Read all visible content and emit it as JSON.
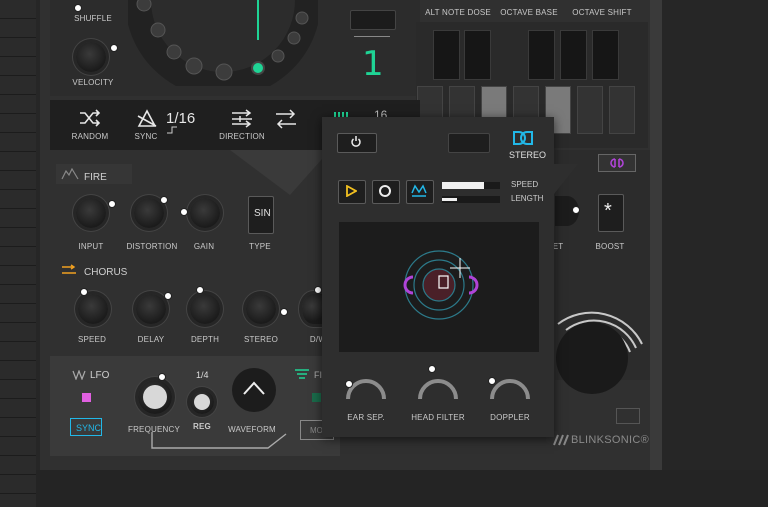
{
  "top": {
    "shuffle_label": "SHUFFLE",
    "velocity_label": "VELOCITY",
    "step_value": "1",
    "alt_note_dose_label": "ALT NOTE DOSE",
    "octave_base_label": "OCTAVE BASE",
    "octave_shift_label": "OCTAVE SHIFT"
  },
  "seqbar": {
    "random_label": "RANDOM",
    "sync_label": "SYNC",
    "rate_value": "1/16",
    "direction_label": "DIRECTION",
    "steps_value": "16"
  },
  "fire": {
    "title": "FIRE",
    "input_label": "INPUT",
    "distortion_label": "DISTORTION",
    "gain_label": "GAIN",
    "type_value": "SIN",
    "type_label": "TYPE"
  },
  "chorus": {
    "title": "CHORUS",
    "speed_label": "SPEED",
    "delay_label": "DELAY",
    "depth_label": "DEPTH",
    "stereo_label": "STEREO",
    "dw_label": "D/W"
  },
  "lfo": {
    "title": "LFO",
    "sync_label": "SYNC",
    "frequency_label": "FREQUENCY",
    "reg_value": "1/4",
    "reg_label": "REG",
    "waveform_label": "WAVEFORM",
    "filter_label": "FI",
    "mod_label": "MO"
  },
  "right": {
    "boost_label": "BOOST",
    "boost_symbol": "*",
    "set_label": "ET",
    "brand": "BLINKSONIC®"
  },
  "stereo_popup": {
    "title": "STEREO",
    "speed_label": "SPEED",
    "length_label": "LENGTH",
    "speed_level": 0.72,
    "length_level": 0.25,
    "ear_sep_label": "EAR SEP.",
    "head_filter_label": "HEAD FILTER",
    "doppler_label": "DOPPLER"
  },
  "colors": {
    "accent_green": "#1fd495",
    "accent_cyan": "#22b8e8",
    "accent_yellow": "#f2c020",
    "accent_purple": "#b044d8",
    "accent_orange": "#f0a020",
    "lfo_pink": "#e060e0"
  }
}
